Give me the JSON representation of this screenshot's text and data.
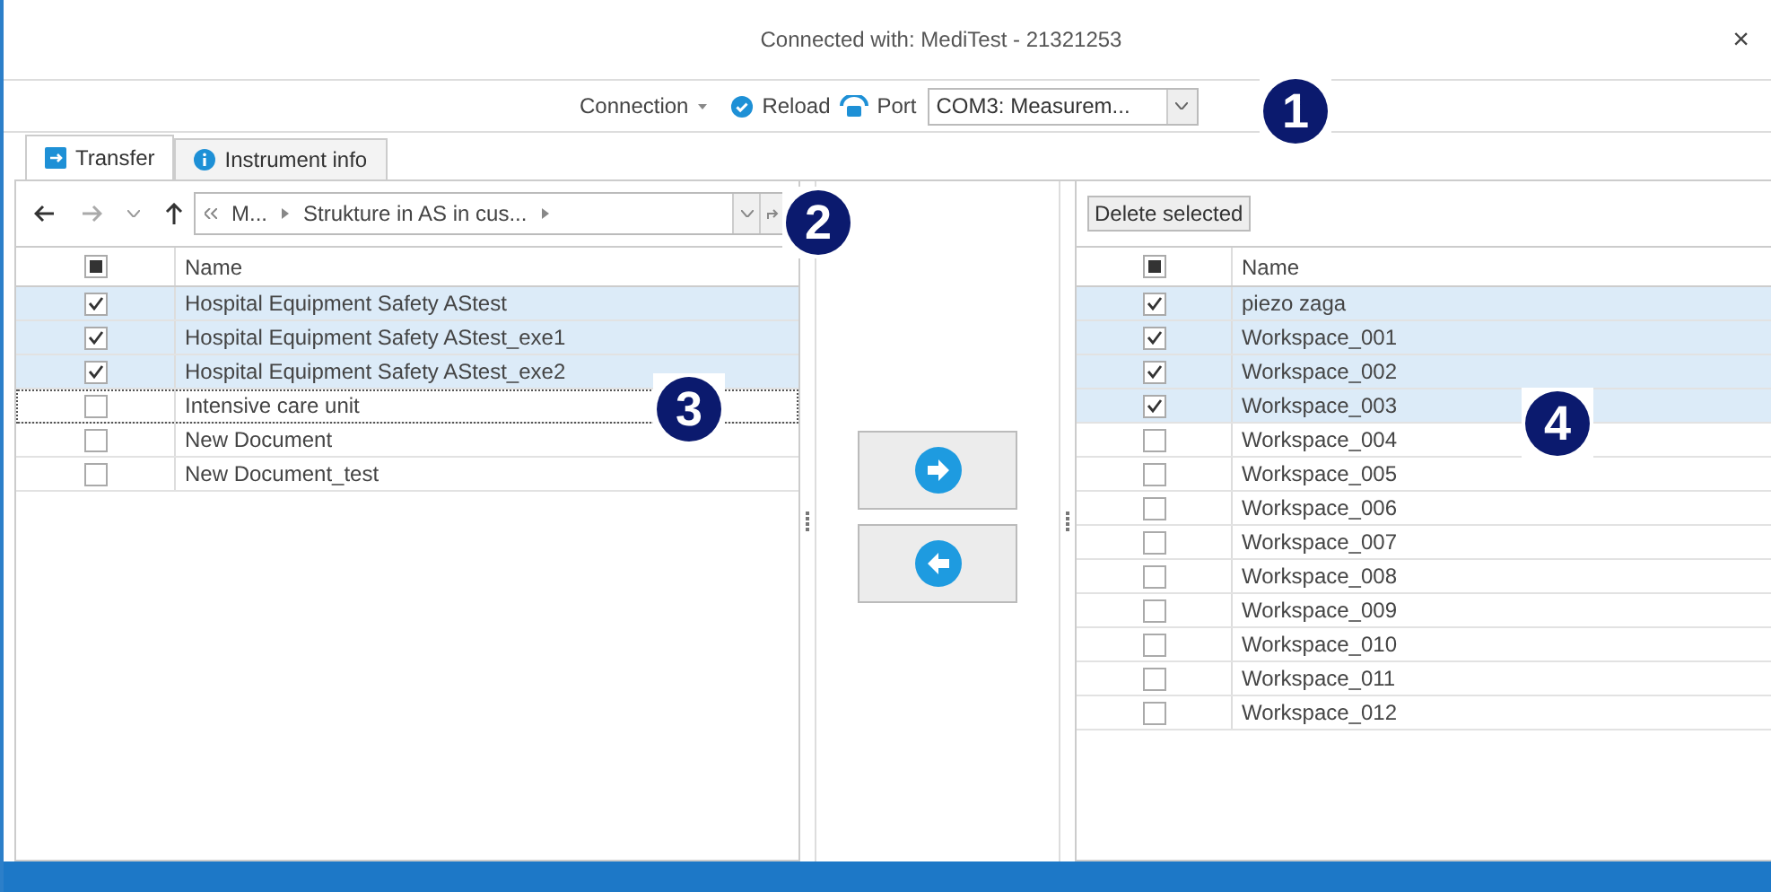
{
  "window": {
    "title": "Connected with: MediTest - 21321253",
    "close": "×"
  },
  "toolbar": {
    "connection": "Connection",
    "reload": "Reload",
    "port_label": "Port",
    "port_value": "COM3: Measurem..."
  },
  "tabs": [
    {
      "label": "Transfer",
      "selected": true,
      "kind": "transfer"
    },
    {
      "label": "Instrument info",
      "selected": false,
      "kind": "info"
    }
  ],
  "left": {
    "path": [
      "M...",
      "Strukture in AS in cus..."
    ],
    "header": {
      "name": "Name",
      "mixed": true
    },
    "rows": [
      {
        "name": "Hospital Equipment Safety AStest",
        "checked": true,
        "focused": false
      },
      {
        "name": "Hospital Equipment Safety AStest_exe1",
        "checked": true,
        "focused": false
      },
      {
        "name": "Hospital Equipment Safety AStest_exe2",
        "checked": true,
        "focused": false
      },
      {
        "name": "Intensive care unit",
        "checked": false,
        "focused": true
      },
      {
        "name": "New Document",
        "checked": false,
        "focused": false
      },
      {
        "name": "New Document_test",
        "checked": false,
        "focused": false
      }
    ]
  },
  "right": {
    "delete_button": "Delete selected",
    "header": {
      "name": "Name",
      "mixed": true
    },
    "rows": [
      {
        "name": "piezo zaga",
        "checked": true
      },
      {
        "name": "Workspace_001",
        "checked": true
      },
      {
        "name": "Workspace_002",
        "checked": true
      },
      {
        "name": "Workspace_003",
        "checked": true
      },
      {
        "name": "Workspace_004",
        "checked": false
      },
      {
        "name": "Workspace_005",
        "checked": false
      },
      {
        "name": "Workspace_006",
        "checked": false
      },
      {
        "name": "Workspace_007",
        "checked": false
      },
      {
        "name": "Workspace_008",
        "checked": false
      },
      {
        "name": "Workspace_009",
        "checked": false
      },
      {
        "name": "Workspace_010",
        "checked": false
      },
      {
        "name": "Workspace_011",
        "checked": false
      },
      {
        "name": "Workspace_012",
        "checked": false
      }
    ]
  },
  "callouts": [
    "1",
    "2",
    "3",
    "4"
  ]
}
